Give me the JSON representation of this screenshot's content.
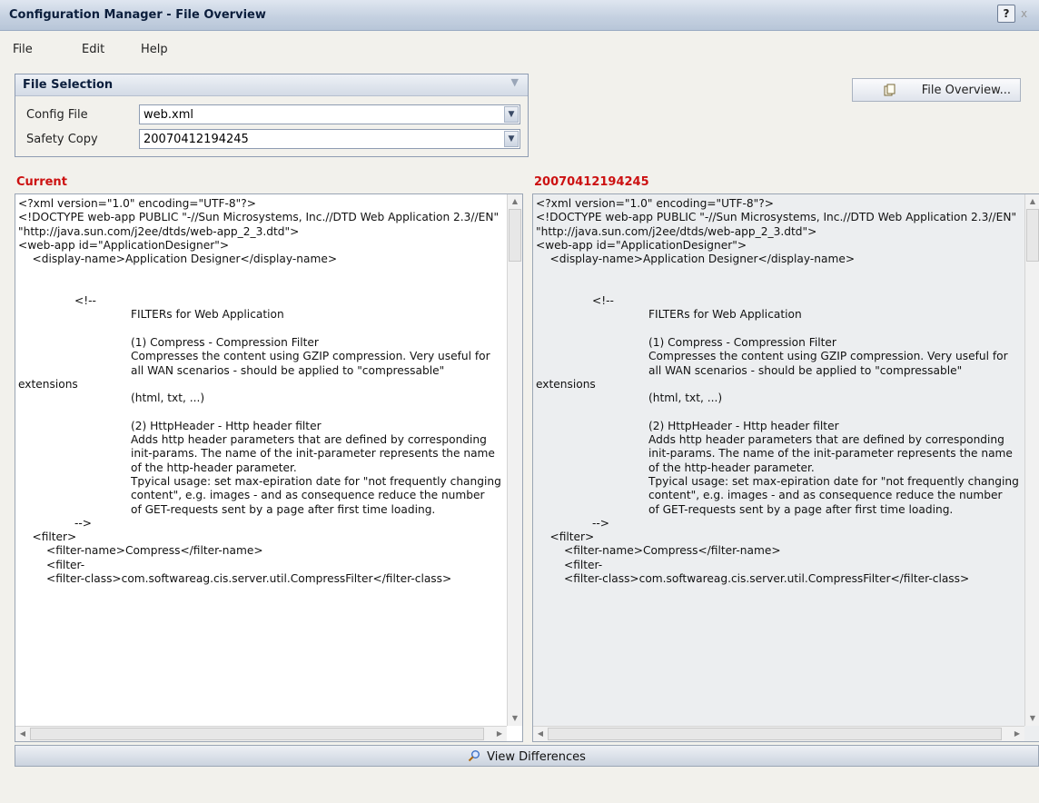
{
  "window": {
    "title": "Configuration Manager - File Overview",
    "help_label": "?",
    "close_label": "x"
  },
  "menu": {
    "items": [
      "File",
      "Edit",
      "Help"
    ]
  },
  "file_selection": {
    "header": "File Selection",
    "config_file_label": "Config File",
    "config_file_value": "web.xml",
    "safety_copy_label": "Safety Copy",
    "safety_copy_value": "20070412194245"
  },
  "file_overview_button": {
    "label": "File Overview..."
  },
  "left_pane": {
    "caption": "Current"
  },
  "right_pane": {
    "caption": "20070412194245"
  },
  "xml_content": "<?xml version=\"1.0\" encoding=\"UTF-8\"?>\n<!DOCTYPE web-app PUBLIC \"-//Sun Microsystems, Inc.//DTD Web Application 2.3//EN\" \"http://java.sun.com/j2ee/dtds/web-app_2_3.dtd\">\n<web-app id=\"ApplicationDesigner\">\n    <display-name>Application Designer</display-name>\n\n\n                <!--\n                                FILTERs for Web Application\n\n                                (1) Compress - Compression Filter\n                                Compresses the content using GZIP compression. Very useful for\n                                all WAN scenarios - should be applied to \"compressable\" extensions\n                                (html, txt, ...)\n\n                                (2) HttpHeader - Http header filter\n                                Adds http header parameters that are defined by corresponding\n                                init-params. The name of the init-parameter represents the name\n                                of the http-header parameter.\n                                Tpyical usage: set max-epiration date for \"not frequently changing\n                                content\", e.g. images - and as consequence reduce the number\n                                of GET-requests sent by a page after first time loading.\n                -->\n    <filter>\n        <filter-name>Compress</filter-name>\n        <filter-\n        <filter-class>com.softwareag.cis.server.util.CompressFilter</filter-class>",
  "view_differences_button": {
    "label": "View Differences"
  },
  "icons": {
    "select_arrow": "chevron-down-icon",
    "file_overview": "files-icon",
    "view_differences": "magnifier-icon"
  },
  "colors": {
    "caption_red": "#cc1111",
    "titlebar": "#c4d0e0"
  }
}
